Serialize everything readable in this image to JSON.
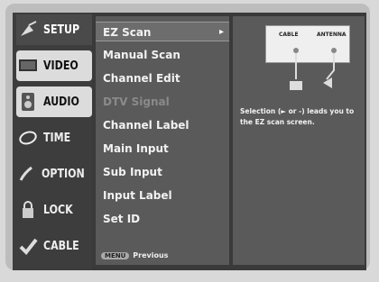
{
  "sidebar": {
    "items": [
      {
        "label": "SETUP",
        "icon": "satellite-dish-icon"
      },
      {
        "label": "VIDEO",
        "icon": "tv-icon"
      },
      {
        "label": "AUDIO",
        "icon": "speaker-icon"
      },
      {
        "label": "TIME",
        "icon": "clock-icon"
      },
      {
        "label": "OPTION",
        "icon": "option-icon"
      },
      {
        "label": "LOCK",
        "icon": "lock-icon"
      },
      {
        "label": "CABLE",
        "icon": "check-icon"
      }
    ]
  },
  "menu": {
    "items": [
      {
        "label": "EZ Scan",
        "state": "active"
      },
      {
        "label": "Manual Scan",
        "state": "normal"
      },
      {
        "label": "Channel Edit",
        "state": "normal"
      },
      {
        "label": "DTV Signal",
        "state": "disabled"
      },
      {
        "label": "Channel Label",
        "state": "normal"
      },
      {
        "label": "Main Input",
        "state": "normal"
      },
      {
        "label": "Sub Input",
        "state": "normal"
      },
      {
        "label": "Input Label",
        "state": "normal"
      },
      {
        "label": "Set ID",
        "state": "normal"
      }
    ],
    "arrow": "▸",
    "footer_key": "MENU",
    "footer_label": "Previous"
  },
  "panel": {
    "diagram": {
      "label_left": "CABLE",
      "label_right": "ANTENNA"
    },
    "description": "Selection (► or -) leads you to the EZ scan screen."
  }
}
